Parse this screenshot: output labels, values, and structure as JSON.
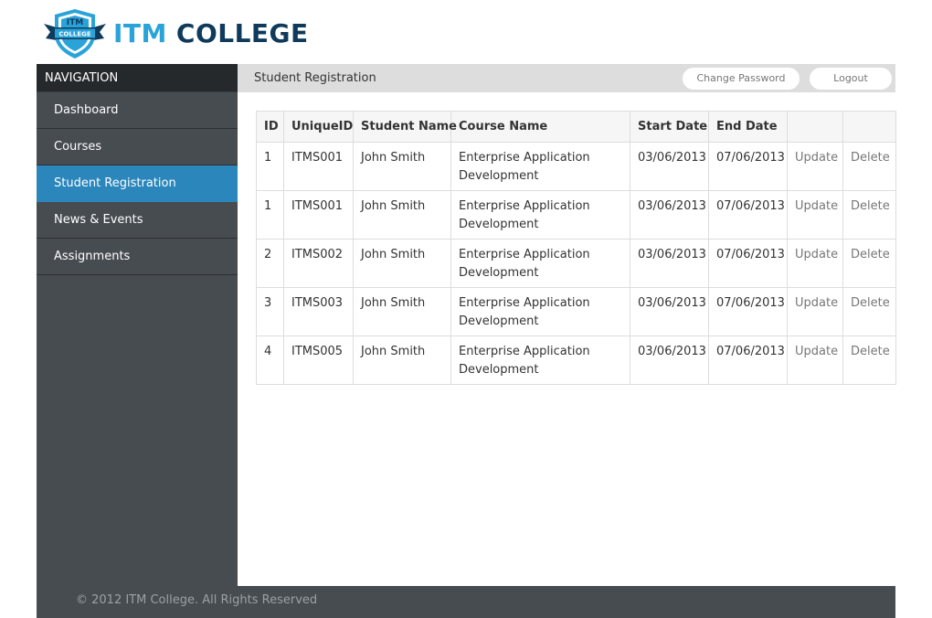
{
  "brand": {
    "emblem_top": "ITM",
    "emblem_ribbon": "COLLEGE",
    "name_part1": "ITM",
    "name_part2": "COLLEGE",
    "colors": {
      "light_blue": "#2aa3d9",
      "dark_blue": "#0f3a5c"
    }
  },
  "sidebar": {
    "header": "NAVIGATION",
    "items": [
      {
        "label": "Dashboard",
        "active": false
      },
      {
        "label": "Courses",
        "active": false
      },
      {
        "label": "Student Registration",
        "active": true
      },
      {
        "label": "News & Events",
        "active": false
      },
      {
        "label": "Assignments",
        "active": false
      }
    ],
    "active_color": "#2a86bb"
  },
  "topbar": {
    "title": "Student Registration",
    "change_password_label": "Change Password",
    "logout_label": "Logout"
  },
  "table": {
    "columns": [
      "ID",
      "UniqueID",
      "Student Name",
      "Course Name",
      "Start Date",
      "End Date",
      "",
      ""
    ],
    "rows": [
      {
        "id": "1",
        "unique_id": "ITMS001",
        "student_name": "John Smith",
        "course_name": "Enterprise Application Development",
        "start_date": "03/06/2013",
        "end_date": "07/06/2013",
        "update": "Update",
        "delete": "Delete"
      },
      {
        "id": "1",
        "unique_id": "ITMS001",
        "student_name": "John Smith",
        "course_name": "Enterprise Application Development",
        "start_date": "03/06/2013",
        "end_date": "07/06/2013",
        "update": "Update",
        "delete": "Delete"
      },
      {
        "id": "2",
        "unique_id": "ITMS002",
        "student_name": "John Smith",
        "course_name": "Enterprise Application Development",
        "start_date": "03/06/2013",
        "end_date": "07/06/2013",
        "update": "Update",
        "delete": "Delete"
      },
      {
        "id": "3",
        "unique_id": "ITMS003",
        "student_name": "John Smith",
        "course_name": "Enterprise Application Development",
        "start_date": "03/06/2013",
        "end_date": "07/06/2013",
        "update": "Update",
        "delete": "Delete"
      },
      {
        "id": "4",
        "unique_id": "ITMS005",
        "student_name": "John Smith",
        "course_name": "Enterprise Application Development",
        "start_date": "03/06/2013",
        "end_date": "07/06/2013",
        "update": "Update",
        "delete": "Delete"
      }
    ]
  },
  "footer": {
    "copyright": "© 2012 ITM College. All Rights Reserved"
  }
}
